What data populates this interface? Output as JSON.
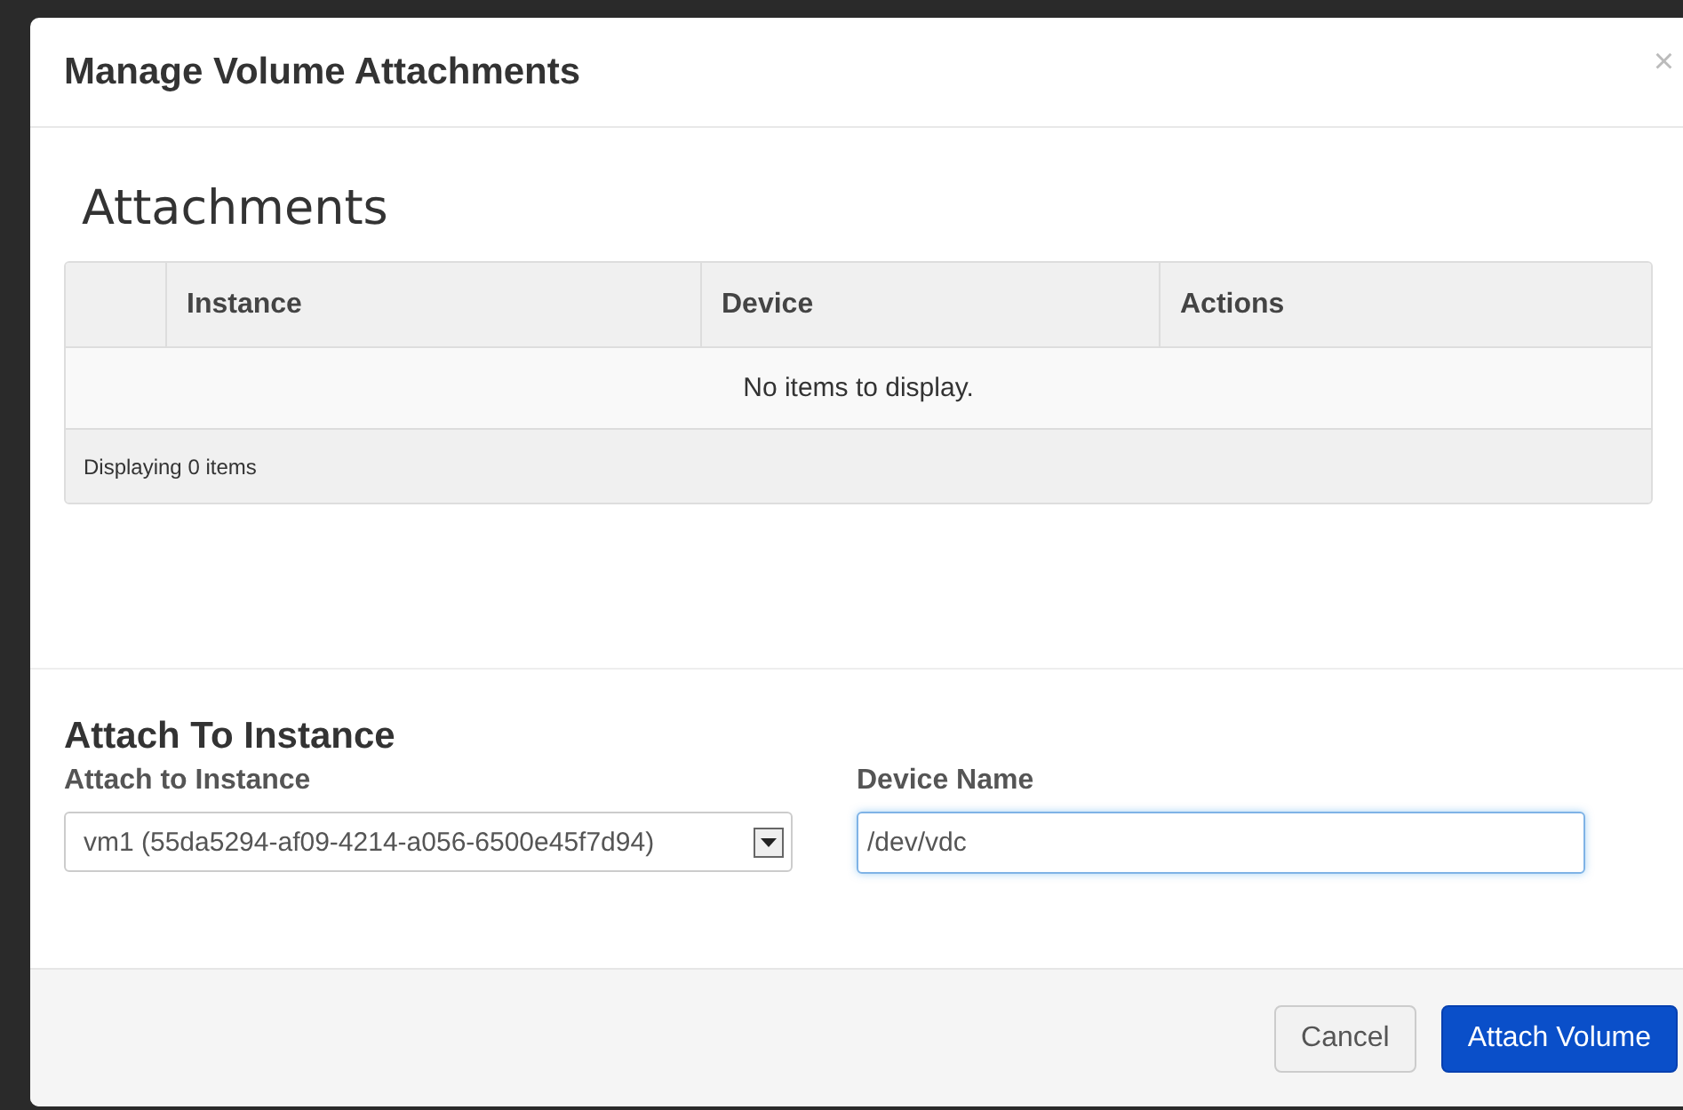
{
  "dialog": {
    "title": "Manage Volume Attachments",
    "close": "×"
  },
  "attachments": {
    "heading": "Attachments",
    "columns": [
      "Instance",
      "Device",
      "Actions"
    ],
    "empty_message": "No items to display.",
    "footer": "Displaying 0 items"
  },
  "attach_form": {
    "heading": "Attach To Instance",
    "instance": {
      "label": "Attach to Instance",
      "value": "vm1 (55da5294-af09-4214-a056-6500e45f7d94)"
    },
    "device": {
      "label": "Device Name",
      "value": "/dev/vdc"
    }
  },
  "buttons": [
    {
      "label": "Cancel",
      "kind": "secondary"
    },
    {
      "label": "Attach Volume",
      "kind": "primary"
    }
  ]
}
